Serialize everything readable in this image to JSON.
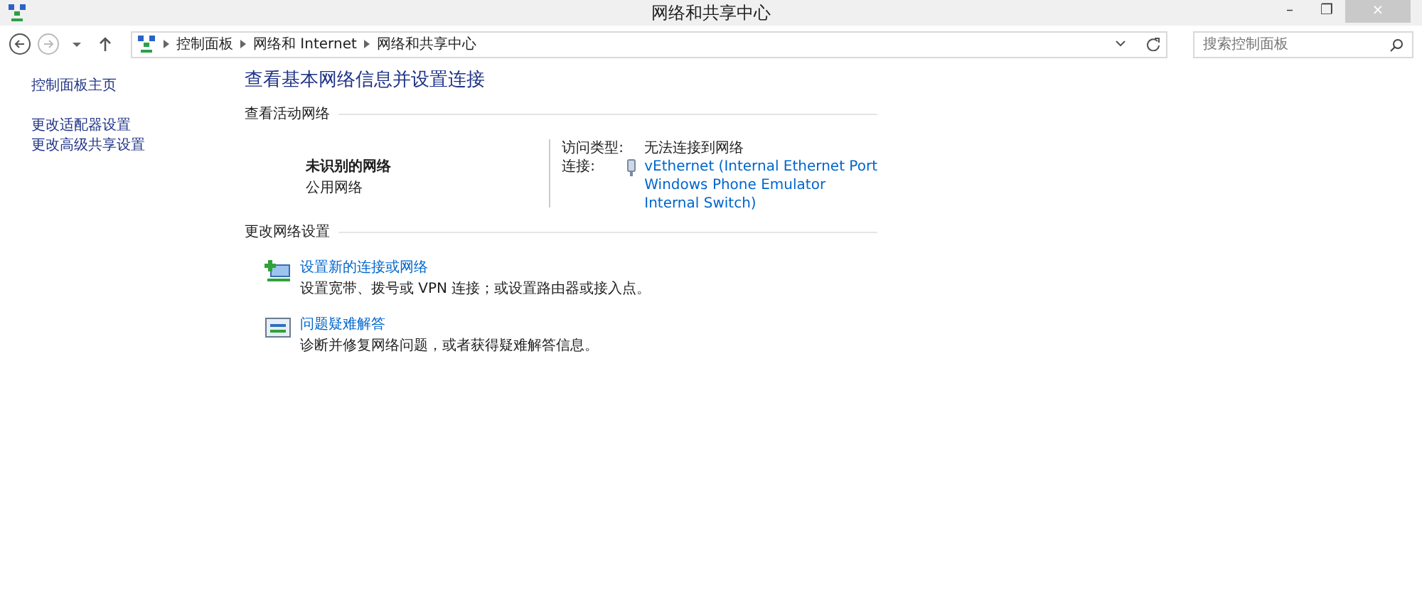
{
  "window": {
    "title": "网络和共享中心",
    "controls": [
      "–",
      "❐",
      "×"
    ]
  },
  "breadcrumb": [
    "控制面板",
    "网络和 Internet",
    "网络和共享中心"
  ],
  "search": {
    "placeholder": "搜索控制面板"
  },
  "sidebar": {
    "items": [
      "控制面板主页",
      "更改适配器设置",
      "更改高级共享设置"
    ]
  },
  "heading": "查看基本网络信息并设置连接",
  "active_networks": {
    "label": "查看活动网络",
    "name": "未识别的网络",
    "category": "公用网络",
    "access_label": "访问类型:",
    "access_value": "无法连接到网络",
    "connection_label": "连接:",
    "connection_lines": [
      "vEthernet (Internal Ethernet Port",
      "Windows Phone Emulator",
      "Internal Switch)"
    ]
  },
  "change_settings": {
    "label": "更改网络设置",
    "tasks": [
      {
        "kind": "setup",
        "title": "设置新的连接或网络",
        "description": "设置宽带、拨号或 VPN 连接；或设置路由器或接入点。"
      },
      {
        "kind": "troubleshoot",
        "title": "问题疑难解答",
        "description": "诊断并修复网络问题，或者获得疑难解答信息。"
      }
    ]
  }
}
